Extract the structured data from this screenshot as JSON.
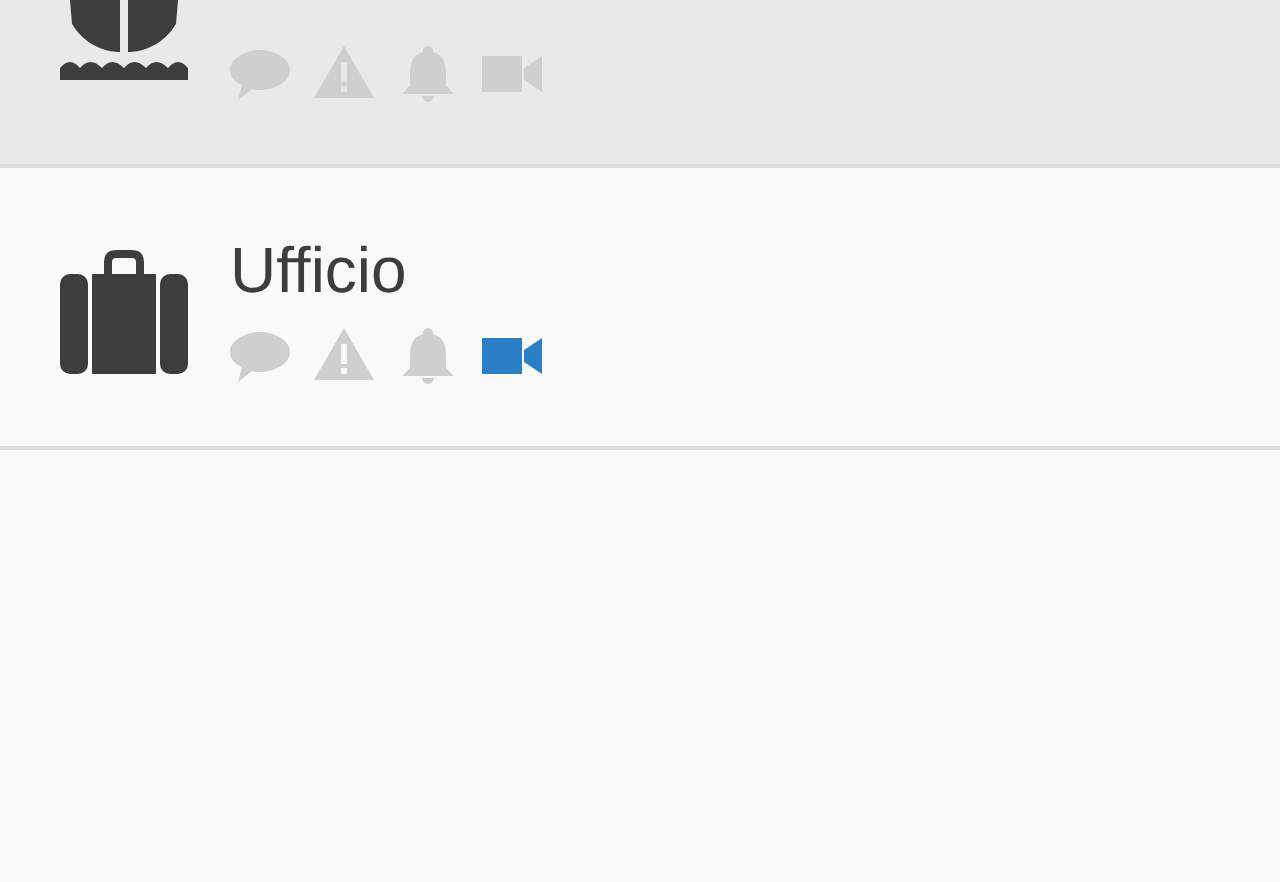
{
  "rows": [
    {
      "kind": "ship",
      "selected": true,
      "alerts": [
        {
          "kind": "chat",
          "on": false
        },
        {
          "kind": "warning",
          "on": false
        },
        {
          "kind": "bell",
          "on": false
        },
        {
          "kind": "video",
          "on": false
        }
      ]
    },
    {
      "kind": "briefcase",
      "title": "Ufficio",
      "selected": false,
      "alerts": [
        {
          "kind": "chat",
          "on": false
        },
        {
          "kind": "warning",
          "on": false
        },
        {
          "kind": "bell",
          "on": false
        },
        {
          "kind": "video",
          "on": true
        }
      ]
    }
  ]
}
